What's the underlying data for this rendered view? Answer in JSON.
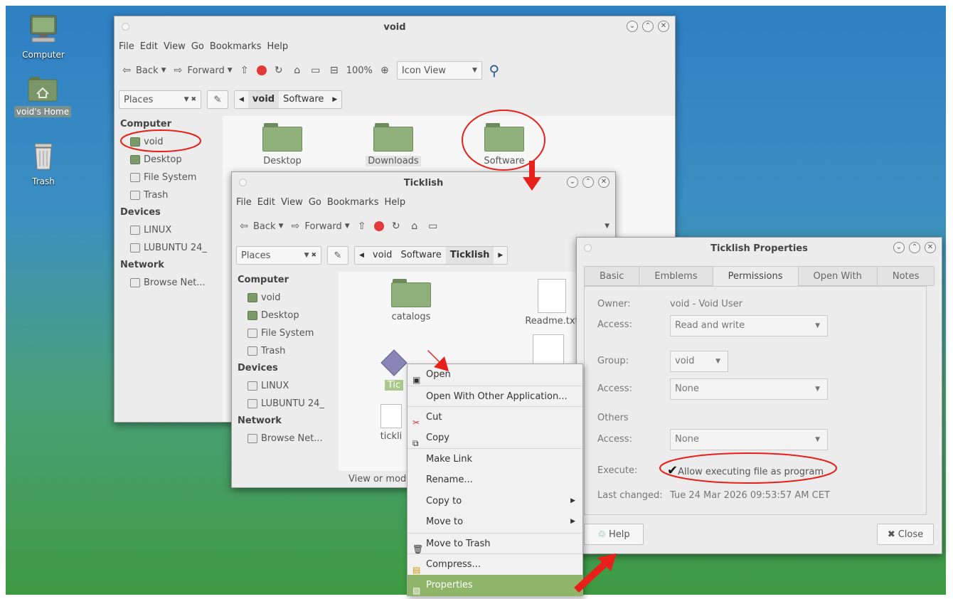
{
  "desktop": {
    "icons": [
      {
        "label": "Computer"
      },
      {
        "label": "void's Home"
      },
      {
        "label": "Trash"
      }
    ]
  },
  "win_void": {
    "title": "void",
    "menu": [
      "File",
      "Edit",
      "View",
      "Go",
      "Bookmarks",
      "Help"
    ],
    "toolbar": {
      "back": "Back",
      "forward": "Forward",
      "zoom": "100%",
      "view_mode": "Icon View"
    },
    "places_label": "Places",
    "breadcrumb": [
      "void",
      "Software"
    ],
    "sidebar": {
      "computer_header": "Computer",
      "computer_items": [
        "void",
        "Desktop",
        "File System",
        "Trash"
      ],
      "devices_header": "Devices",
      "devices_items": [
        "LINUX",
        "LUBUNTU 24_"
      ],
      "network_header": "Network",
      "network_items": [
        "Browse Net..."
      ]
    },
    "files": [
      {
        "name": "Desktop"
      },
      {
        "name": "Downloads"
      },
      {
        "name": "Software"
      }
    ]
  },
  "win_ticklish": {
    "title": "Ticklish",
    "menu": [
      "File",
      "Edit",
      "View",
      "Go",
      "Bookmarks",
      "Help"
    ],
    "toolbar": {
      "back": "Back",
      "forward": "Forward"
    },
    "places_label": "Places",
    "breadcrumb": [
      "void",
      "Software",
      "Ticklish"
    ],
    "sidebar": {
      "computer_header": "Computer",
      "computer_items": [
        "void",
        "Desktop",
        "File System",
        "Trash"
      ],
      "devices_header": "Devices",
      "devices_items": [
        "LINUX",
        "LUBUNTU 24_"
      ],
      "network_header": "Network",
      "network_items": [
        "Browse Net..."
      ]
    },
    "files": [
      {
        "name": "catalogs"
      },
      {
        "name": "Readme.txt"
      },
      {
        "name": "Tic"
      },
      {
        "name": "tickli"
      }
    ],
    "status": "View or modi"
  },
  "context_menu": {
    "items": [
      "Open",
      "Open With Other Application...",
      "Cut",
      "Copy",
      "Make Link",
      "Rename...",
      "Copy to",
      "Move to",
      "Move to Trash",
      "Compress...",
      "Properties"
    ]
  },
  "properties": {
    "title": "Ticklish Properties",
    "tabs": [
      "Basic",
      "Emblems",
      "Permissions",
      "Open With",
      "Notes"
    ],
    "owner_label": "Owner:",
    "owner_value": "void - Void User",
    "access_label": "Access:",
    "owner_access": "Read and write",
    "group_label": "Group:",
    "group_value": "void",
    "group_access": "None",
    "others_label": "Others",
    "others_access": "None",
    "execute_label": "Execute:",
    "execute_check": "Allow executing file as program",
    "changed_label": "Last changed:",
    "changed_value": "Tue 24 Mar 2026 09:53:57 AM CET",
    "help_button": "Help",
    "close_button": "Close"
  },
  "annotation_color": "#e8201a",
  "accent_color": "#8fb56a"
}
